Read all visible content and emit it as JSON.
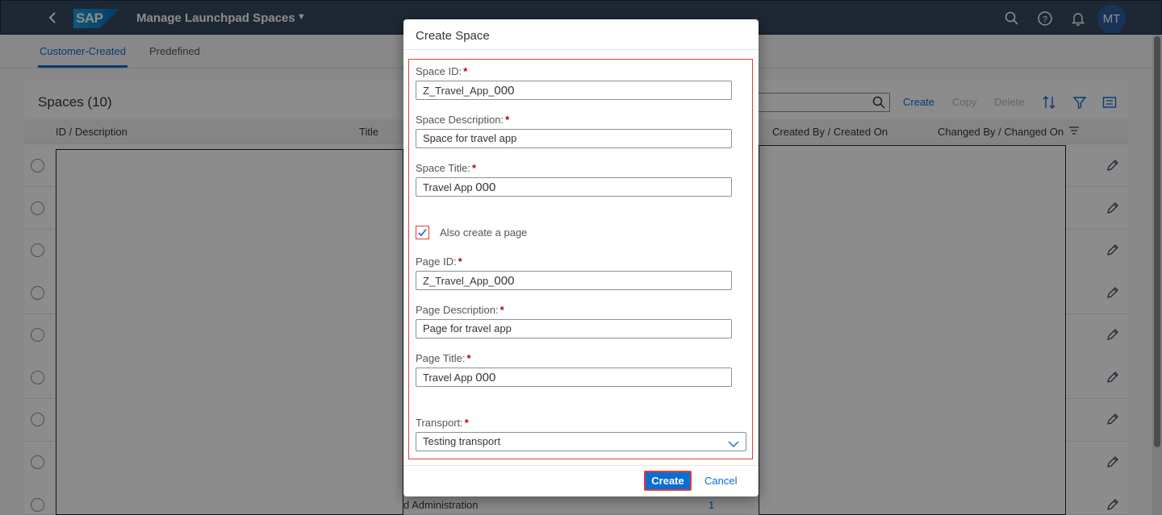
{
  "shell": {
    "logo_text": "SAP",
    "title": "Manage Launchpad Spaces",
    "avatar_initials": "MT"
  },
  "tabs": [
    {
      "label": "Customer-Created"
    },
    {
      "label": "Predefined"
    }
  ],
  "spaces": {
    "title": "Spaces (10)",
    "toolbar": {
      "create": "Create",
      "copy": "Copy",
      "delete": "Delete"
    },
    "columns": {
      "id_desc": "ID / Description",
      "title": "Title",
      "created": "Created By / Created On",
      "changed": "Changed By / Changed On"
    },
    "last_row": {
      "title_fragment": "d Administration",
      "count": "1"
    }
  },
  "dialog": {
    "title": "Create Space",
    "space_id": {
      "label": "Space ID:",
      "value": "Z_Travel_App_",
      "suffix": "000"
    },
    "space_description": {
      "label": "Space Description:",
      "value": "Space for travel app"
    },
    "space_title": {
      "label": "Space Title:",
      "value": "Travel App ",
      "suffix": "000"
    },
    "also_create_page": {
      "label": "Also create a page",
      "checked": true
    },
    "page_id": {
      "label": "Page ID:",
      "value": "Z_Travel_App_",
      "suffix": "000"
    },
    "page_description": {
      "label": "Page Description:",
      "value": "Page for travel app"
    },
    "page_title": {
      "label": "Page Title:",
      "value": "Travel App ",
      "suffix": "000"
    },
    "transport": {
      "label": "Transport:",
      "value": "Testing transport"
    },
    "required_mark": "*",
    "create_button": "Create",
    "cancel_button": "Cancel"
  },
  "colors": {
    "shell": "#354a5f",
    "accent": "#0a6ed1",
    "highlight": "#e03d3d"
  }
}
